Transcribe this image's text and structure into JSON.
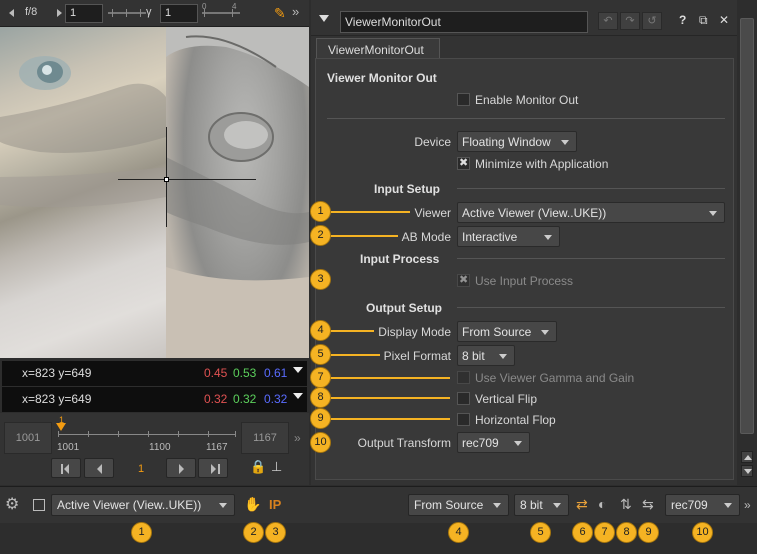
{
  "viewer": {
    "toolbar": {
      "fstop": "f/8",
      "gain_value": "1",
      "gamma_label": "γ",
      "gamma_value": "1",
      "gamma_scale_min": "0",
      "gamma_scale_max": "4"
    },
    "pixel_info": [
      {
        "coord": "x=823 y=649",
        "r": "0.45",
        "g": "0.53",
        "b": "0.61"
      },
      {
        "coord": "x=823 y=649",
        "r": "0.32",
        "g": "0.32",
        "b": "0.32"
      }
    ],
    "timeline": {
      "start_frame": "1001",
      "end_frame": "1167",
      "ruler_labels": [
        "1001",
        "1100",
        "1167"
      ],
      "cursor_label": "1",
      "current_frame": "1"
    }
  },
  "properties": {
    "node_name": "ViewerMonitorOut",
    "tab_label": "ViewerMonitorOut",
    "section_viewer_monitor_out": "Viewer Monitor Out",
    "enable_monitor_out": {
      "label": "Enable Monitor Out",
      "checked": false
    },
    "device": {
      "label": "Device",
      "value": "Floating Window"
    },
    "minimize_with_application": {
      "label": "Minimize with Application",
      "checked": true
    },
    "section_input_setup": "Input Setup",
    "viewer_field": {
      "label": "Viewer",
      "value": "Active Viewer (View..UKE))"
    },
    "ab_mode": {
      "label": "AB Mode",
      "value": "Interactive"
    },
    "section_input_process": "Input Process",
    "use_input_process": {
      "label": "Use Input Process",
      "checked": true,
      "disabled": true
    },
    "section_output_setup": "Output Setup",
    "display_mode": {
      "label": "Display Mode",
      "value": "From Source"
    },
    "pixel_format": {
      "label": "Pixel Format",
      "value": "8 bit"
    },
    "use_viewer_gamma_gain": {
      "label": "Use Viewer Gamma and Gain",
      "checked": false,
      "disabled": true
    },
    "vertical_flip": {
      "label": "Vertical Flip",
      "checked": false
    },
    "horizontal_flop": {
      "label": "Horizontal Flop",
      "checked": false
    },
    "output_transform": {
      "label": "Output Transform",
      "value": "rec709"
    },
    "header_icons": {
      "help": "?",
      "float": "⧉",
      "close": "✕"
    }
  },
  "bottom_bar": {
    "viewer_dropdown": "Active Viewer (View..UKE))",
    "ip_label": "IP",
    "display_mode": "From Source",
    "pixel_format": "8 bit",
    "output_transform": "rec709"
  },
  "callouts": {
    "side": [
      "1",
      "2",
      "3",
      "4",
      "5",
      "7",
      "8",
      "9",
      "10"
    ],
    "bottom": [
      "1",
      "2",
      "3",
      "4",
      "5",
      "6",
      "7",
      "8",
      "9",
      "10"
    ]
  },
  "colors": {
    "callout": "#f5b323",
    "red_channel": "#e05252",
    "green_channel": "#5cd05c",
    "blue_channel": "#5a6cff",
    "accent_orange": "#f39c12"
  }
}
